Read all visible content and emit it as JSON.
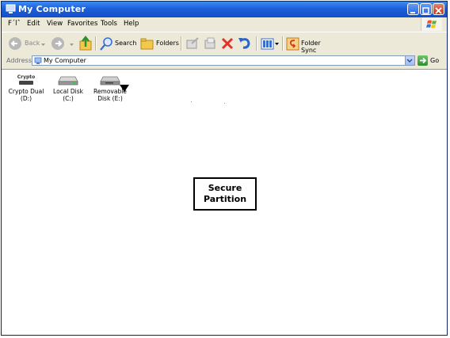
{
  "window": {
    "title": "My Computer"
  },
  "menu": {
    "items": [
      {
        "label": "File",
        "display": "F´lˆ"
      },
      {
        "label": "Edit"
      },
      {
        "label": "View"
      },
      {
        "label": "Favorites"
      },
      {
        "label": "Tools"
      },
      {
        "label": "Help"
      }
    ]
  },
  "toolbar": {
    "back_label": "Back",
    "search_label": "Search",
    "folders_label": "Folders",
    "folder_sync_label": "Folder Sync"
  },
  "address": {
    "label": "Address",
    "value": "My Computer",
    "go_label": "Go"
  },
  "drives": [
    {
      "label": "Crypto Dual (D:)",
      "line1": "Crypto Dual",
      "line2": "(D:)",
      "icon": "crypto-drive-icon",
      "icon_text": "Crypto"
    },
    {
      "label": "Local Disk (C:)",
      "line1": "Local Disk (C:)",
      "line2": "",
      "icon": "hard-disk-icon"
    },
    {
      "label": "Removable Disk (E:)",
      "line1": "Removable",
      "line2": "Disk (E:)",
      "icon": "removable-disk-icon"
    }
  ],
  "annotation": {
    "line1": "Secure",
    "line2": "Partition"
  },
  "colors": {
    "titlebar": "#1c5fd8",
    "chrome": "#ece9d8",
    "content_bg": "#ffffff"
  }
}
